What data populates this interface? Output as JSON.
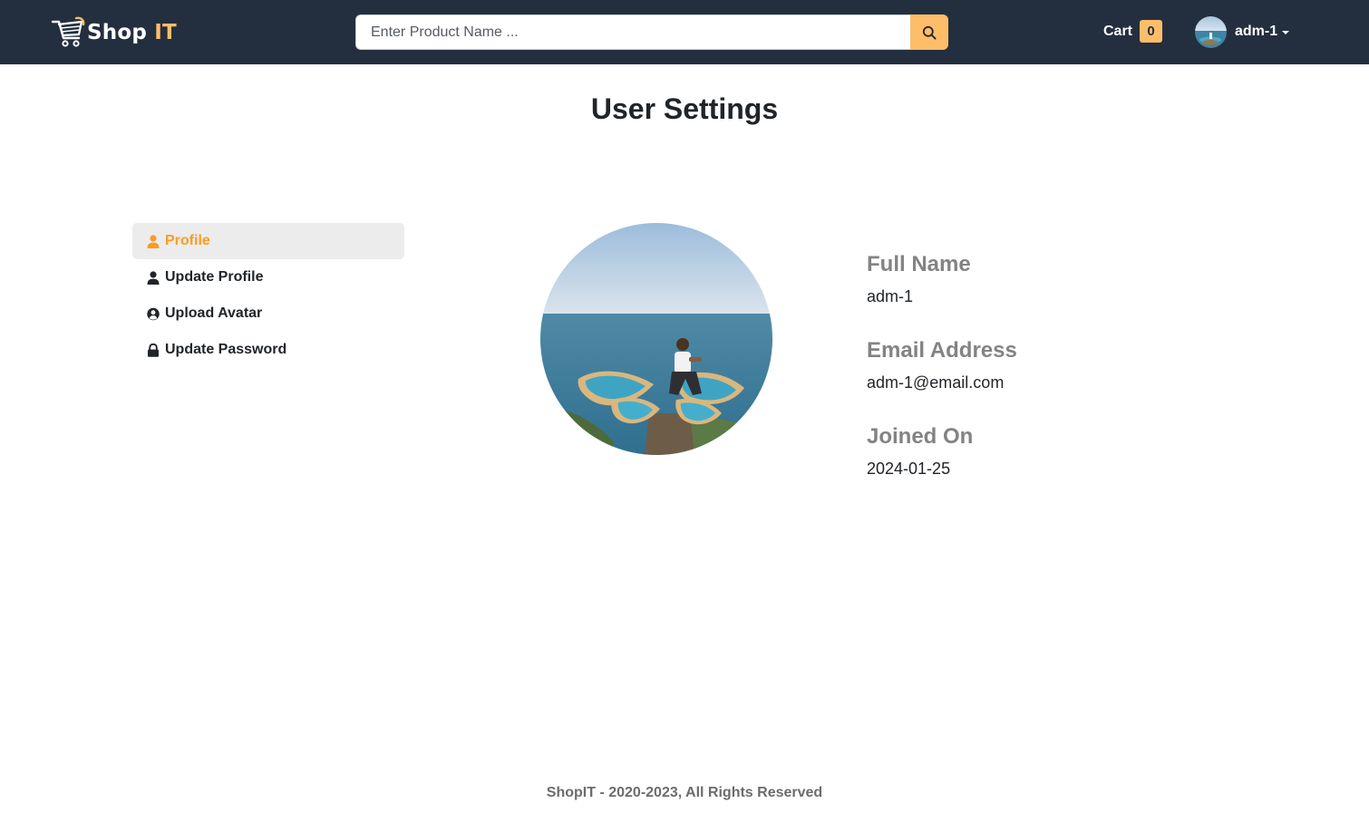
{
  "brand": {
    "name_part1": "Shop",
    "name_part2": "IT"
  },
  "search": {
    "placeholder": "Enter Product Name ..."
  },
  "cart": {
    "label": "Cart",
    "count": "0"
  },
  "user": {
    "name": "adm-1"
  },
  "page": {
    "title": "User Settings"
  },
  "sidebar": {
    "items": [
      {
        "label": "Profile",
        "icon": "user-icon",
        "active": true
      },
      {
        "label": "Update Profile",
        "icon": "user-icon",
        "active": false
      },
      {
        "label": "Upload Avatar",
        "icon": "user-circle-icon",
        "active": false
      },
      {
        "label": "Update Password",
        "icon": "lock-icon",
        "active": false
      }
    ]
  },
  "profile": {
    "full_name_label": "Full Name",
    "full_name": "adm-1",
    "email_label": "Email Address",
    "email": "adm-1@email.com",
    "joined_label": "Joined On",
    "joined": "2024-01-25"
  },
  "footer": {
    "text": "ShopIT - 2020-2023, All Rights Reserved"
  },
  "colors": {
    "navbar": "#232f3e",
    "accent": "#febd69",
    "active": "#fa9c23",
    "label_gray": "#838383"
  }
}
